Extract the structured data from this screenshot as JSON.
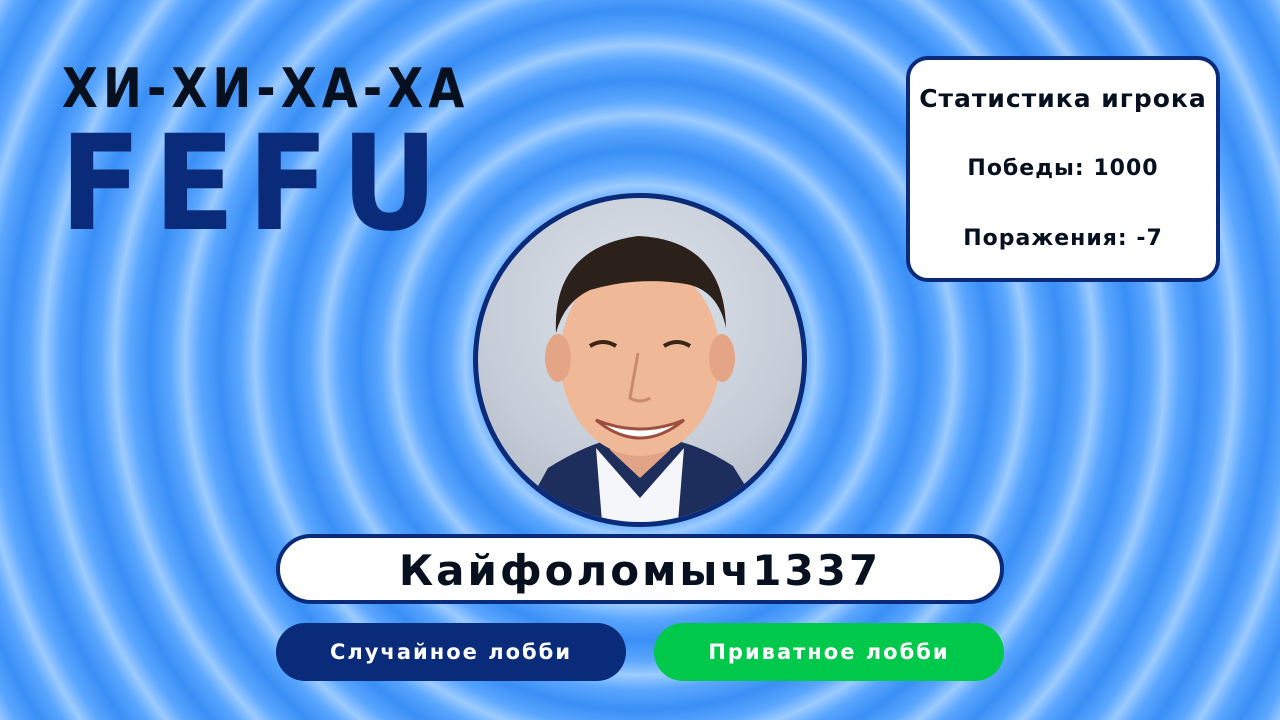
{
  "header": {
    "title_top": "ХИ-ХИ-ХА-ХА",
    "title_brand": "FEFU"
  },
  "stats": {
    "title": "Статистика игрока",
    "wins": "Победы: 1000",
    "losses": "Поражения: -7"
  },
  "player": {
    "name": "Кайфоломыч1337",
    "avatar": "player-photo"
  },
  "buttons": {
    "random_lobby": "Случайное лобби",
    "private_lobby": "Приватное лобби"
  },
  "colors": {
    "brand_navy": "#0a2a7a",
    "accent_green": "#00c84a",
    "background_blue": "#3a8ff5"
  }
}
